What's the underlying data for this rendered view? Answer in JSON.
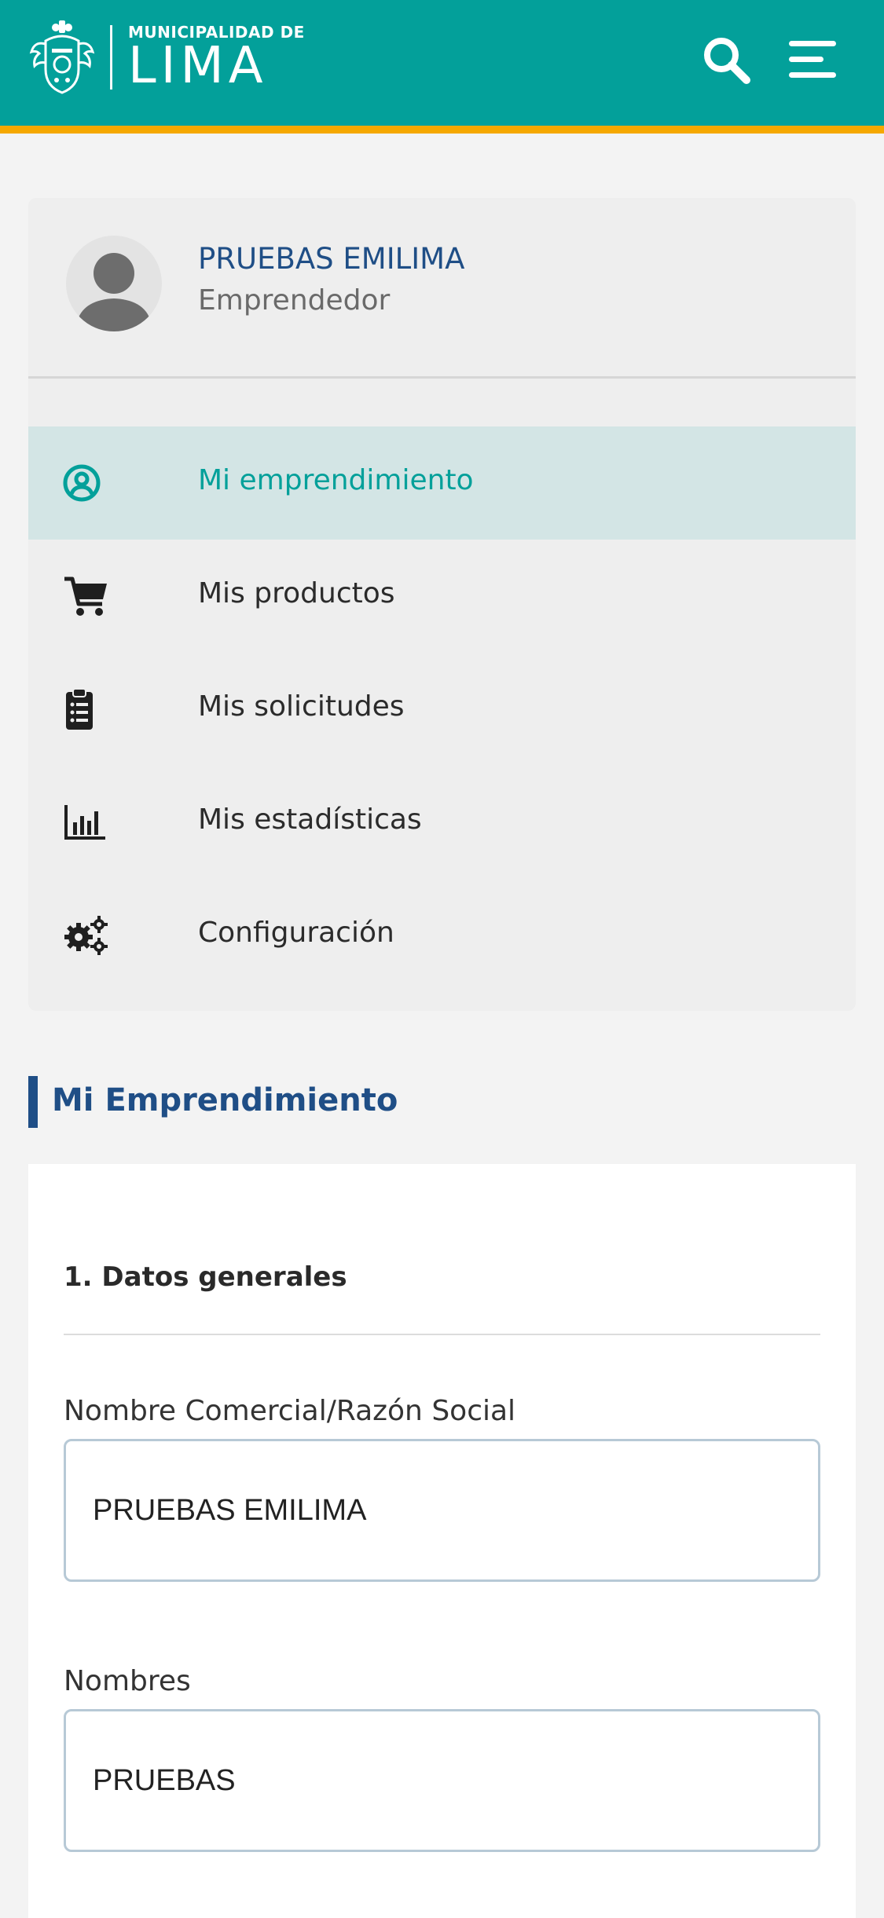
{
  "header": {
    "logo_small": "MUNICIPALIDAD DE",
    "logo_big": "LIMA",
    "brand_color": "#03a09a",
    "accent_color": "#f5a800"
  },
  "profile": {
    "name": "PRUEBAS EMILIMA",
    "role": "Emprendedor"
  },
  "menu": {
    "items": [
      {
        "label": "Mi emprendimiento",
        "icon": "user-circle-icon",
        "active": true
      },
      {
        "label": "Mis productos",
        "icon": "shopping-cart-icon",
        "active": false
      },
      {
        "label": "Mis solicitudes",
        "icon": "clipboard-list-icon",
        "active": false
      },
      {
        "label": "Mis estadísticas",
        "icon": "bar-chart-icon",
        "active": false
      },
      {
        "label": "Configuración",
        "icon": "gears-icon",
        "active": false
      }
    ]
  },
  "section": {
    "title": "Mi Emprendimiento",
    "subtitle": "1. Datos generales"
  },
  "form": {
    "business_name_label": "Nombre Comercial/Razón Social",
    "business_name_value": "PRUEBAS EMILIMA",
    "names_label": "Nombres",
    "names_value": "PRUEBAS"
  }
}
